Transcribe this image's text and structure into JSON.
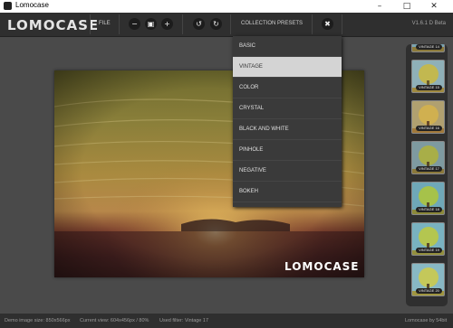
{
  "window": {
    "title": "Lomocase",
    "controls": {
      "minimize": "–",
      "maximize": "□",
      "close": "✕"
    }
  },
  "toolbar": {
    "logo": "LOMOCASE",
    "file": "FILE",
    "zoom_out": "−",
    "fit": "▣",
    "zoom_in": "+",
    "rotate_left": "↺",
    "rotate_right": "↻",
    "presets": "COLLECTION PRESETS",
    "close_presets": "✖",
    "version": "V1.6.1 D Beta"
  },
  "presets_menu": {
    "items": [
      {
        "label": "BASIC"
      },
      {
        "label": "VINTAGE",
        "selected": true
      },
      {
        "label": "COLOR"
      },
      {
        "label": "CRYSTAL"
      },
      {
        "label": "BLACK AND WHITE"
      },
      {
        "label": "PINHOLE"
      },
      {
        "label": "NEGATIVE"
      },
      {
        "label": "BOKEH"
      }
    ]
  },
  "photo": {
    "logo": "LOMOCASE"
  },
  "thumbnails": [
    {
      "label": "VINTAGE 14"
    },
    {
      "label": "VINTAGE 15"
    },
    {
      "label": "VINTAGE 16"
    },
    {
      "label": "VINTAGE 17"
    },
    {
      "label": "VINTAGE 18"
    },
    {
      "label": "VINTAGE 19"
    },
    {
      "label": "VINTAGE 20"
    }
  ],
  "status": {
    "image_size": "Demo image size: 850x566px",
    "current_view": "Current view: 604x456px / 80%",
    "filter": "Used filter: Vintage 17",
    "build": "Lomocase by 54bit"
  },
  "colors": {
    "toolbar_bg": "#2f2f2f",
    "workspace_bg": "#4a4a4a",
    "menu_bg": "#3a3a3a",
    "menu_selected": "#d4d4d4"
  }
}
